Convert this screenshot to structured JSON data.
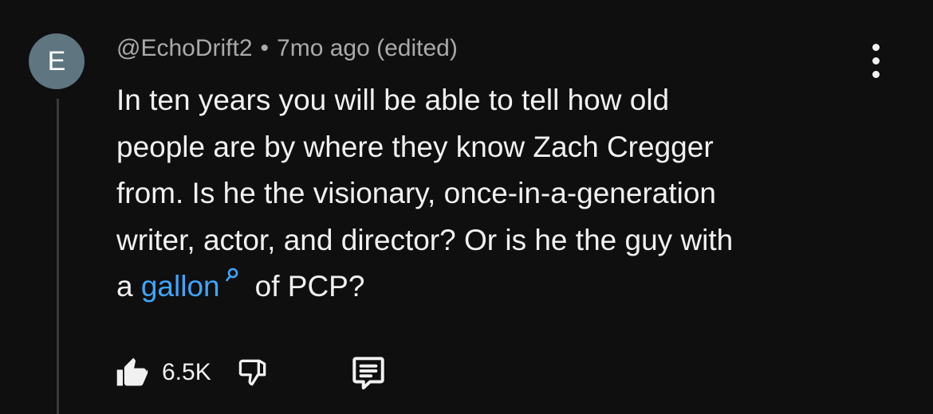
{
  "avatar": {
    "initial": "E",
    "color": "#5f7580"
  },
  "comment": {
    "author": "@EchoDrift2",
    "separator": "•",
    "timestamp": "7mo ago (edited)",
    "lines": [
      "In ten years you will be able to tell how old",
      "people are by where they know Zach Cregger",
      "from. Is he the visionary, once-in-a-generation",
      "writer, actor, and director? Or is he the guy with"
    ],
    "last_line_prefix": "a ",
    "link_text": "gallon",
    "last_line_suffix": "of PCP?"
  },
  "actions": {
    "like_icon": "thumbs-up-icon",
    "like_count": "6.5K",
    "dislike_icon": "thumbs-down-icon",
    "reply_icon": "reply-comment-icon"
  },
  "colors": {
    "background": "#0f0f0f",
    "text": "#f1f1f1",
    "meta": "#aaaaaa",
    "link": "#3ea6ff",
    "thread_line": "#3a3a3a"
  }
}
